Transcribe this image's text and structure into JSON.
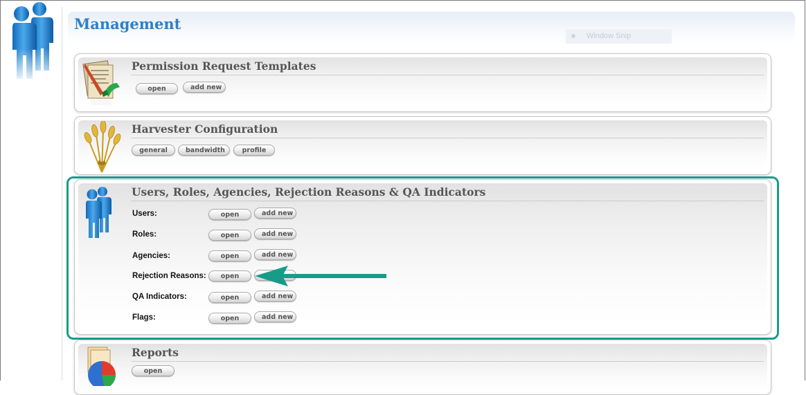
{
  "page": {
    "title": "Management",
    "snip_text": "Window Snip"
  },
  "cards": {
    "permission": {
      "title": "Permission Request Templates",
      "buttons": [
        "open",
        "add new"
      ]
    },
    "harvester": {
      "title": "Harvester Configuration",
      "buttons": [
        "general",
        "bandwidth",
        "profile"
      ]
    },
    "users": {
      "title": "Users, Roles, Agencies, Rejection Reasons & QA Indicators",
      "rows": [
        {
          "label": "Users:",
          "open": "open",
          "add": "add new"
        },
        {
          "label": "Roles:",
          "open": "open",
          "add": "add new"
        },
        {
          "label": "Agencies:",
          "open": "open",
          "add": "add new"
        },
        {
          "label": "Rejection Reasons:",
          "open": "open",
          "add": ""
        },
        {
          "label": "QA Indicators:",
          "open": "open",
          "add": "add new"
        },
        {
          "label": "Flags:",
          "open": "open",
          "add": "add new"
        }
      ]
    },
    "reports": {
      "title": "Reports",
      "buttons": [
        "open"
      ]
    }
  },
  "colors": {
    "title_blue": "#2f7fc6",
    "highlight_teal": "#189c8a",
    "card_title_gray": "#555555"
  },
  "icons": {
    "left_rail": "users-icon",
    "permission": "document-edit-icon",
    "harvester": "wheat-icon",
    "users": "users-icon",
    "reports": "pie-chart-icon"
  }
}
